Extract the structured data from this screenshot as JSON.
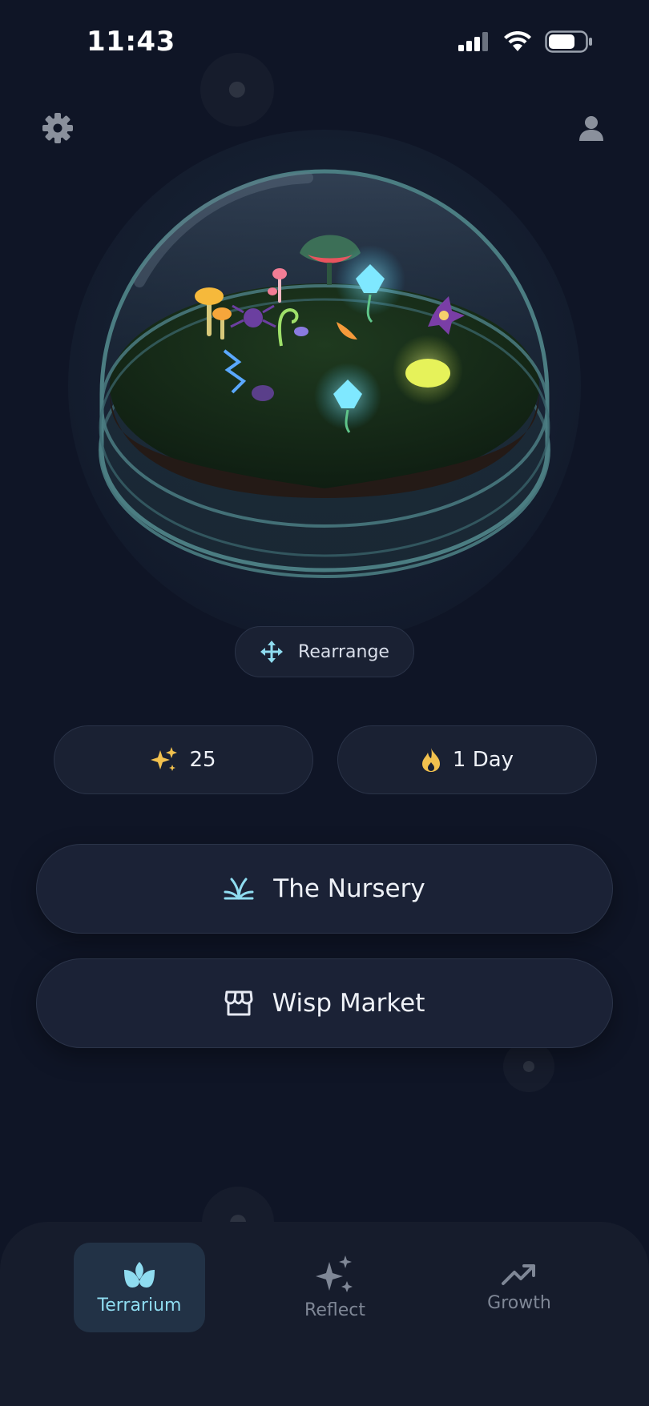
{
  "status_bar": {
    "time": "11:43"
  },
  "header": {
    "settings_icon": "gear-icon",
    "profile_icon": "person-icon"
  },
  "terrarium": {
    "rearrange_label": "Rearrange"
  },
  "stats": {
    "sparkles": "25",
    "streak": "1 Day"
  },
  "actions": {
    "nursery_label": "The Nursery",
    "market_label": "Wisp Market"
  },
  "tabs": [
    {
      "label": "Terrarium",
      "icon": "lotus-icon",
      "active": true
    },
    {
      "label": "Reflect",
      "icon": "sparkles-icon",
      "active": false
    },
    {
      "label": "Growth",
      "icon": "trending-up-icon",
      "active": false
    }
  ],
  "colors": {
    "background": "#0f1526",
    "accent": "#8fdcf0",
    "gold": "#f2c14e"
  }
}
